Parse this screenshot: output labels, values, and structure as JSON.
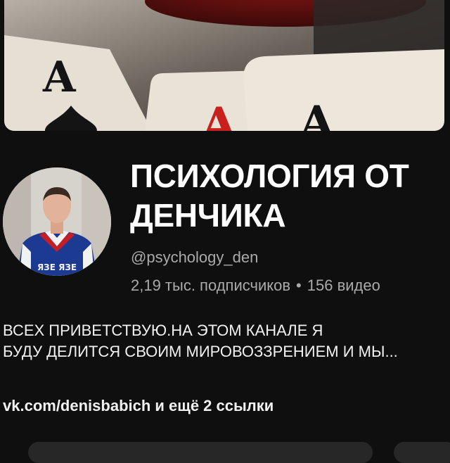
{
  "channel": {
    "title_line1": "ПСИХОЛОГИЯ ОТ",
    "title_line2": "ДЕНЧИКА",
    "handle": "@psychology_den",
    "subscribers": "2,19 тыс. подписчиков",
    "separator": "•",
    "videos": "156 видео",
    "description_line1": "ВСЕХ ПРИВЕТСТВУЮ.НА ЭТОМ КАНАЛЕ Я",
    "description_line2": "БУДУ ДЕЛИТСЯ СВОИМ МИРОВОЗЗРЕНИЕМ И МЫ...",
    "links": "vk.com/denisbabich и ещё 2 ссылки"
  },
  "banner": {
    "card_letter": "A",
    "card_colors": {
      "black": "#141414",
      "red": "#c8201c"
    }
  },
  "avatar": {
    "jacket_text": "ЯЗЕ ЯЗЕ",
    "colors": {
      "jacket_blue": "#1d3a93",
      "jacket_white": "#f2f2f2",
      "jacket_red": "#c41e28"
    }
  },
  "theme": {
    "background": "#0f0f0f",
    "text_primary": "#f1f1f1",
    "text_secondary": "#aaaaaa"
  }
}
